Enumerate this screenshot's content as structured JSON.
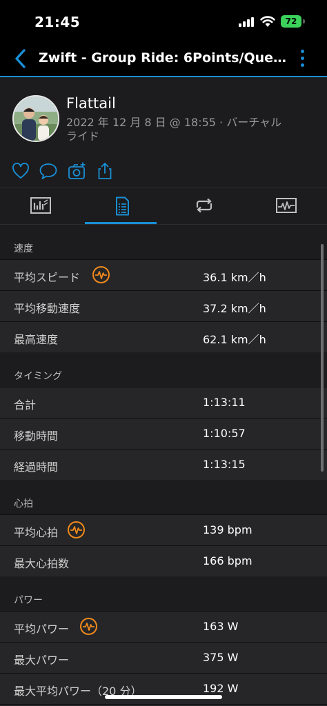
{
  "status_bar": {
    "time": "21:45",
    "battery": "72"
  },
  "nav": {
    "title": "Zwift - Group Ride: 6Points/Quest...",
    "accent": "#1a8fd6"
  },
  "profile": {
    "name": "Flattail",
    "meta": "2022 年 12 月 8 日 @ 18:55 · バーチャルライド"
  },
  "actions": [
    "heart-icon",
    "comment-icon",
    "add-photo-icon",
    "share-icon"
  ],
  "tabs": [
    "overview-tab",
    "stats-tab",
    "laps-tab",
    "charts-tab"
  ],
  "sections": [
    {
      "header": "速度",
      "rows": [
        {
          "label": "平均スピード",
          "value": "36.1 km／h",
          "hr": true
        },
        {
          "label": "平均移動速度",
          "value": "37.2 km／h"
        },
        {
          "label": "最高速度",
          "value": "62.1 km／h"
        }
      ]
    },
    {
      "header": "タイミング",
      "rows": [
        {
          "label": "合計",
          "value": "1:13:11"
        },
        {
          "label": "移動時間",
          "value": "1:10:57"
        },
        {
          "label": "経過時間",
          "value": "1:13:15"
        }
      ]
    },
    {
      "header": "心拍",
      "rows": [
        {
          "label": "平均心拍",
          "value": "139 bpm",
          "hr": true
        },
        {
          "label": "最大心拍数",
          "value": "166 bpm"
        }
      ]
    },
    {
      "header": "パワー",
      "rows": [
        {
          "label": "平均パワー",
          "value": "163 W",
          "hr": true
        },
        {
          "label": "最大パワー",
          "value": "375 W"
        },
        {
          "label": "最大平均パワー（20 分）",
          "value": "192 W"
        }
      ]
    }
  ]
}
